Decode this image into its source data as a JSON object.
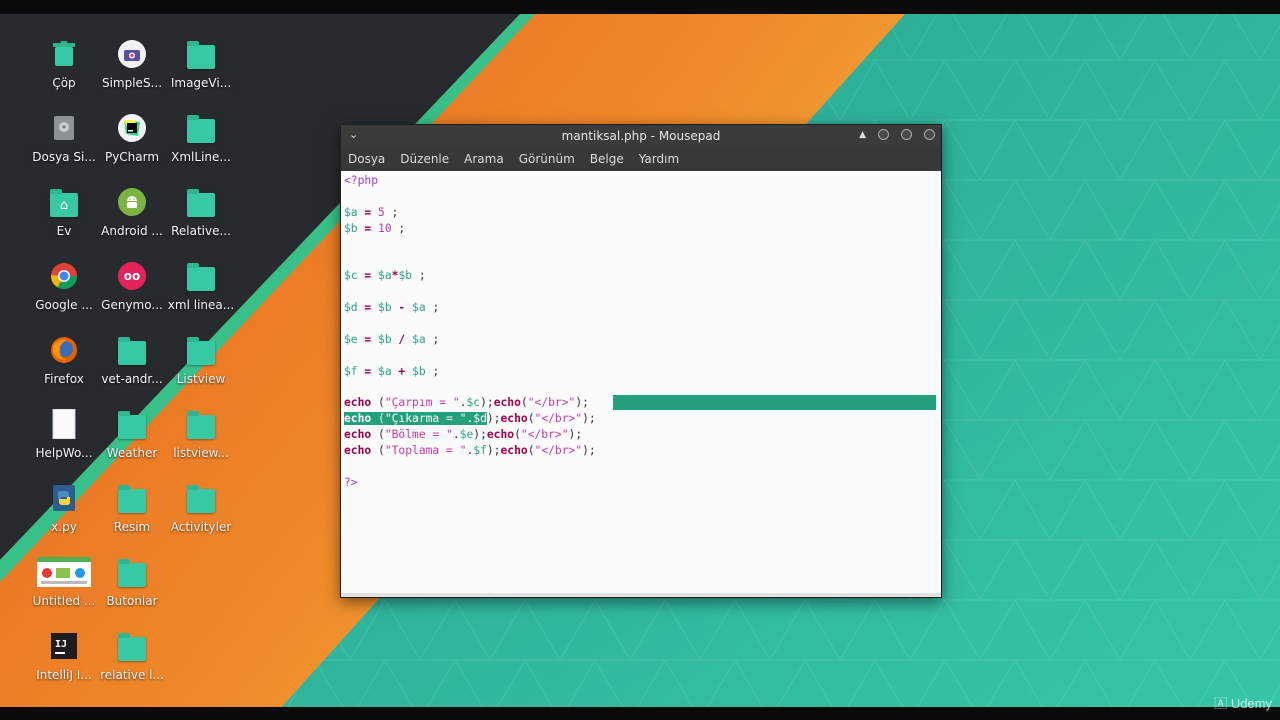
{
  "desktop": {
    "icons": [
      {
        "label": "Çöp",
        "icon": "trash-icon"
      },
      {
        "label": "SimpleS...",
        "icon": "camera-icon"
      },
      {
        "label": "ImageVi...",
        "icon": "folder-icon"
      },
      {
        "label": "Dosya Si...",
        "icon": "file-system-icon"
      },
      {
        "label": "PyCharm",
        "icon": "pycharm-icon"
      },
      {
        "label": "XmlLine...",
        "icon": "folder-icon"
      },
      {
        "label": "Ev",
        "icon": "home-folder-icon"
      },
      {
        "label": "Android ...",
        "icon": "android-icon"
      },
      {
        "label": "Relative...",
        "icon": "folder-icon"
      },
      {
        "label": "Google ...",
        "icon": "chrome-icon"
      },
      {
        "label": "Genymo...",
        "icon": "genymotion-icon"
      },
      {
        "label": "xml linea...",
        "icon": "folder-icon"
      },
      {
        "label": "Firefox",
        "icon": "firefox-icon"
      },
      {
        "label": "vet-andr...",
        "icon": "folder-icon"
      },
      {
        "label": "Listview",
        "icon": "folder-icon"
      },
      {
        "label": "HelpWo...",
        "icon": "document-icon"
      },
      {
        "label": "Weather",
        "icon": "folder-icon"
      },
      {
        "label": "listview...",
        "icon": "folder-icon"
      },
      {
        "label": "x.py",
        "icon": "python-file-icon"
      },
      {
        "label": "Resim",
        "icon": "folder-icon"
      },
      {
        "label": "Activityler",
        "icon": "folder-icon"
      },
      {
        "label": "Untitled ...",
        "icon": "image-file-icon"
      },
      {
        "label": "Butonlar",
        "icon": "folder-icon"
      },
      {
        "label": "IntelliJ I...",
        "icon": "intellij-icon"
      },
      {
        "label": "relative l...",
        "icon": "folder-icon"
      }
    ]
  },
  "window": {
    "title": "mantiksal.php - Mousepad",
    "menu": [
      "Dosya",
      "Düzenle",
      "Arama",
      "Görünüm",
      "Belge",
      "Yardım"
    ]
  },
  "editor": {
    "lines": {
      "l1": "<?php",
      "a_var": "$a",
      "a_eq": " = ",
      "a_val": "5",
      "a_end": " ;",
      "b_var": "$b",
      "b_eq": " = ",
      "b_val": "10",
      "b_end": " ;",
      "c_var": "$c",
      "c_eq": " = ",
      "c_x": "$a",
      "c_op": "*",
      "c_y": "$b",
      "c_end": " ;",
      "d_var": "$d",
      "d_eq": " = ",
      "d_x": "$b",
      "d_op": " - ",
      "d_y": "$a",
      "d_end": " ;",
      "e_var": "$e",
      "e_eq": " = ",
      "e_x": "$b",
      "e_op": " / ",
      "e_y": "$a",
      "e_end": " ;",
      "f_var": "$f",
      "f_eq": " = ",
      "f_x": "$a",
      "f_op": " + ",
      "f_y": "$b",
      "f_end": " ;",
      "echo": "echo",
      "e1_open": " (",
      "e1_str": "\"Çarpım = \"",
      "e1_dot": ".",
      "e1_var": "$c",
      "e1_close": ");",
      "e1_echo": "echo",
      "e1_p": "(",
      "e1_br": "\"</br>\"",
      "e1_end": ");",
      "e2_open": " (",
      "e2_str": "\"Çıkarma = \"",
      "e2_dot": ".",
      "e2_var": "$d",
      "e2_close": ");",
      "e2_echo": "echo",
      "e2_p": "(",
      "e2_br": "\"</br>\"",
      "e2_end": ");",
      "e3_open": " (",
      "e3_str": "\"Bölme = \"",
      "e3_dot": ".",
      "e3_var": "$e",
      "e3_close": ");",
      "e3_echo": "echo",
      "e3_p": "(",
      "e3_br": "\"</br>\"",
      "e3_end": ");",
      "e4_open": " (",
      "e4_str": "\"Toplama = \"",
      "e4_dot": ".",
      "e4_var": "$f",
      "e4_close": ");",
      "e4_echo": "echo",
      "e4_p": "(",
      "e4_br": "\"</br>\"",
      "e4_end": ");",
      "close": "?>"
    }
  },
  "watermark": "Udemy",
  "colors": {
    "accent": "#24a07e",
    "folder": "#36c9a3",
    "wall_dark": "#2b2f33",
    "wall_orange": "#ef7a22",
    "wall_teal": "#2fb7a0"
  }
}
